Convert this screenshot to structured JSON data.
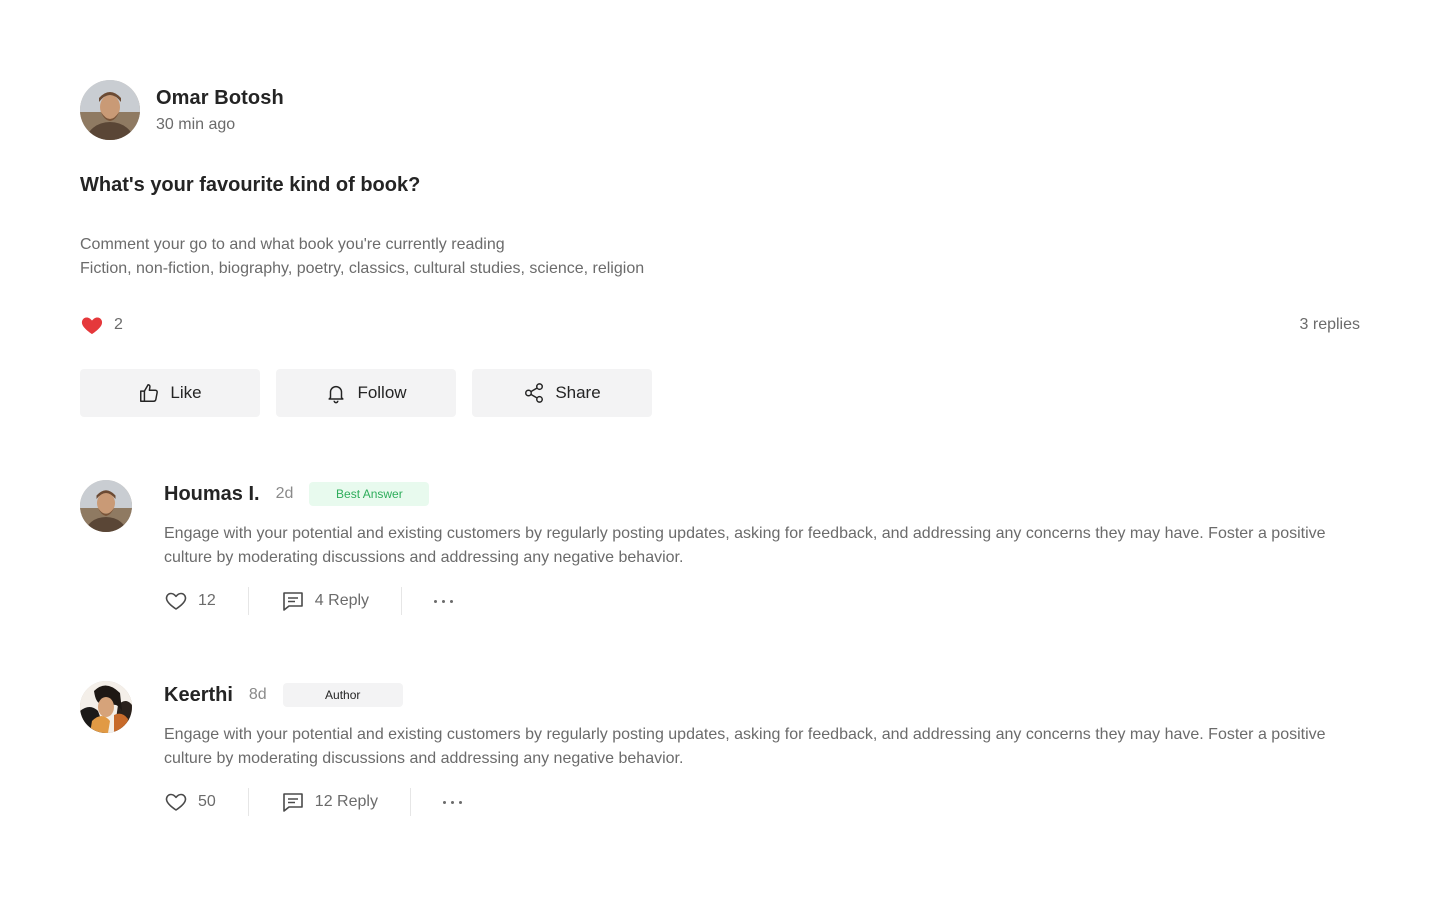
{
  "post": {
    "author": {
      "name": "Omar Botosh",
      "time": "30 min ago"
    },
    "title": "What's your favourite kind of book?",
    "body": [
      "Comment your go to and what book you're currently reading",
      "Fiction, non-fiction, biography, poetry, classics, cultural studies, science, religion"
    ],
    "likes": "2",
    "replies": "3 replies",
    "actions": {
      "like": "Like",
      "follow": "Follow",
      "share": "Share"
    }
  },
  "comments": [
    {
      "name": "Houmas I.",
      "age": "2d",
      "badge": "Best Answer",
      "text": "Engage with your potential and existing customers by regularly posting updates, asking for feedback, and addressing any concerns they may have. Foster a positive culture by moderating discussions and addressing any negative behavior.",
      "likes": "12",
      "reply": "4 Reply"
    },
    {
      "name": "Keerthi",
      "age": "8d",
      "badge": "Author",
      "text": "Engage with your potential and existing customers by regularly posting updates, asking for feedback, and addressing any concerns they may have. Foster a positive culture by moderating discussions and addressing any negative behavior.",
      "likes": "50",
      "reply": "12 Reply"
    }
  ],
  "colors": {
    "heart": "#e5383b",
    "best_badge_bg": "#e8faee",
    "best_badge_text": "#2ead5b",
    "button_bg": "#f3f3f4"
  },
  "icons": [
    "heart-filled-icon",
    "thumbs-up-icon",
    "bell-icon",
    "share-icon",
    "heart-outline-icon",
    "comment-icon",
    "more-icon"
  ]
}
